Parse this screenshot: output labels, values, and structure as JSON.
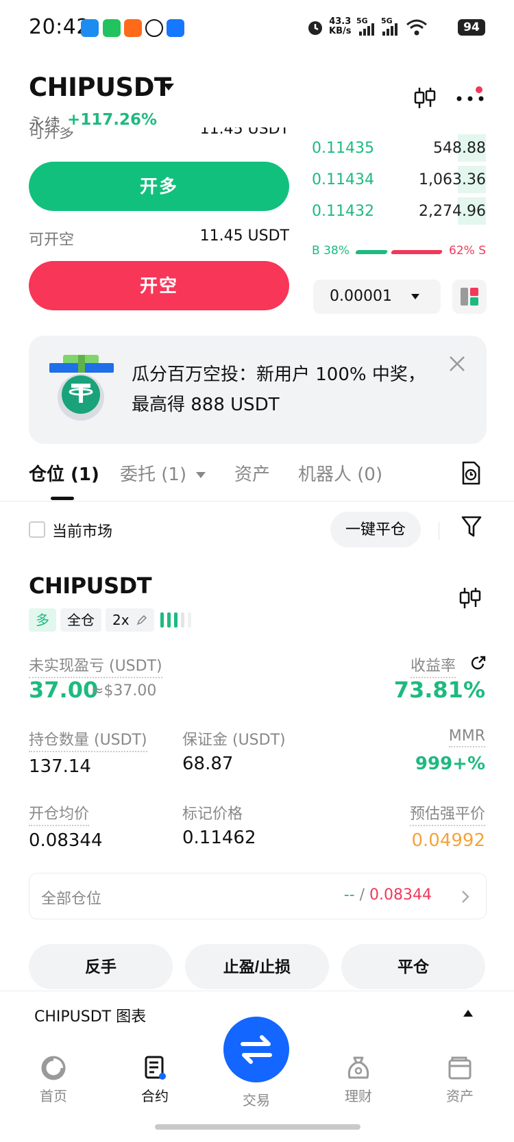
{
  "status_bar": {
    "time": "20:42",
    "net_speed": "43.3",
    "net_unit": "KB/s",
    "sig1": "5G",
    "sig2": "5G",
    "battery": "94"
  },
  "header": {
    "pair": "CHIPUSDT",
    "type_label": "永续",
    "change": "+117.26%"
  },
  "trade_panel": {
    "long_available_label": "可开多",
    "long_available_value": "11.45 USDT",
    "long_button": "开多",
    "short_available_label": "可开空",
    "short_available_value": "11.45 USDT",
    "short_button": "开空"
  },
  "orderbook": {
    "bids": [
      {
        "price": "0.11435",
        "qty": "548.88",
        "depth": 0.16
      },
      {
        "price": "0.11434",
        "qty": "1,063.36",
        "depth": 0.16
      },
      {
        "price": "0.11432",
        "qty": "2,274.96",
        "depth": 0.16
      }
    ],
    "buy_ratio": "B 38%",
    "sell_ratio": "62% S",
    "buy_fraction": 0.38,
    "step": "0.00001"
  },
  "banner": {
    "text": "瓜分百万空投：新用户 100% 中奖，最高得 888 USDT"
  },
  "tabs": {
    "positions": "仓位 (1)",
    "orders": "委托 (1)",
    "assets": "资产",
    "bots": "机器人 (0)"
  },
  "filters": {
    "current_market": "当前市场",
    "close_all": "一键平仓"
  },
  "position": {
    "symbol": "CHIPUSDT",
    "side_tag": "多",
    "margin_mode": "全仓",
    "leverage": "2x",
    "upnl_label": "未实现盈亏 (USDT)",
    "upnl_value": "37.00",
    "upnl_usd": "≈$37.00",
    "roe_label": "收益率",
    "roe_value": "73.81%",
    "qty_label": "持仓数量 (USDT)",
    "qty_value": "137.14",
    "margin_label": "保证金 (USDT)",
    "margin_value": "68.87",
    "mmr_label": "MMR",
    "mmr_value": "999+%",
    "entry_label": "开仓均价",
    "entry_value": "0.08344",
    "mark_label": "标记价格",
    "mark_value": "0.11462",
    "liq_label": "预估强平价",
    "liq_value": "0.04992"
  },
  "all_positions": {
    "label": "全部仓位",
    "value_left": "--",
    "separator": " / ",
    "value_right": "0.08344"
  },
  "actions": {
    "reverse": "反手",
    "tpsl": "止盈/止损",
    "close": "平仓"
  },
  "chart_bar": {
    "label": "CHIPUSDT 图表"
  },
  "nav": {
    "home": "首页",
    "futures": "合约",
    "trade": "交易",
    "earn": "理财",
    "assets": "资产"
  },
  "colors": {
    "green": "#1dba7f",
    "red": "#f73658",
    "orange": "#f5a33b",
    "brand_blue": "#1366ff"
  }
}
